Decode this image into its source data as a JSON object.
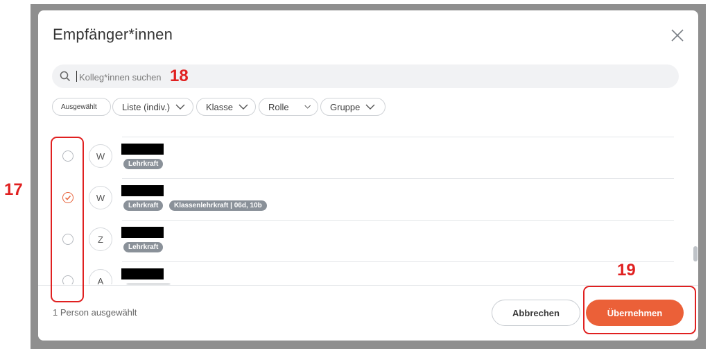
{
  "dialog": {
    "title": "Empfänger*innen",
    "close_icon": "close-icon"
  },
  "search": {
    "placeholder": "Kolleg*innen suchen",
    "icon": "search-icon"
  },
  "filters": [
    {
      "label": "Ausgewählt"
    },
    {
      "label": "Liste (indiv.)"
    },
    {
      "label": "Klasse"
    },
    {
      "label": "Rolle"
    },
    {
      "label": "Gruppe"
    }
  ],
  "people": [
    {
      "initial": "W",
      "selected": false,
      "badges": [
        "Lehrkraft"
      ]
    },
    {
      "initial": "W",
      "selected": true,
      "badges": [
        "Lehrkraft",
        "Klassenlehrkraft | 06d, 10b"
      ]
    },
    {
      "initial": "Z",
      "selected": false,
      "badges": [
        "Lehrkraft"
      ]
    },
    {
      "initial": "A",
      "selected": false,
      "badges": []
    }
  ],
  "footer": {
    "selected_count": "1 Person ausgewählt",
    "cancel_label": "Abbrechen",
    "apply_label": "Übernehmen"
  },
  "annotations": {
    "a17": "17",
    "a18": "18",
    "a19": "19"
  },
  "colors": {
    "accent": "#eb6038",
    "annotation": "#e02020",
    "badge": "#8a9199"
  }
}
